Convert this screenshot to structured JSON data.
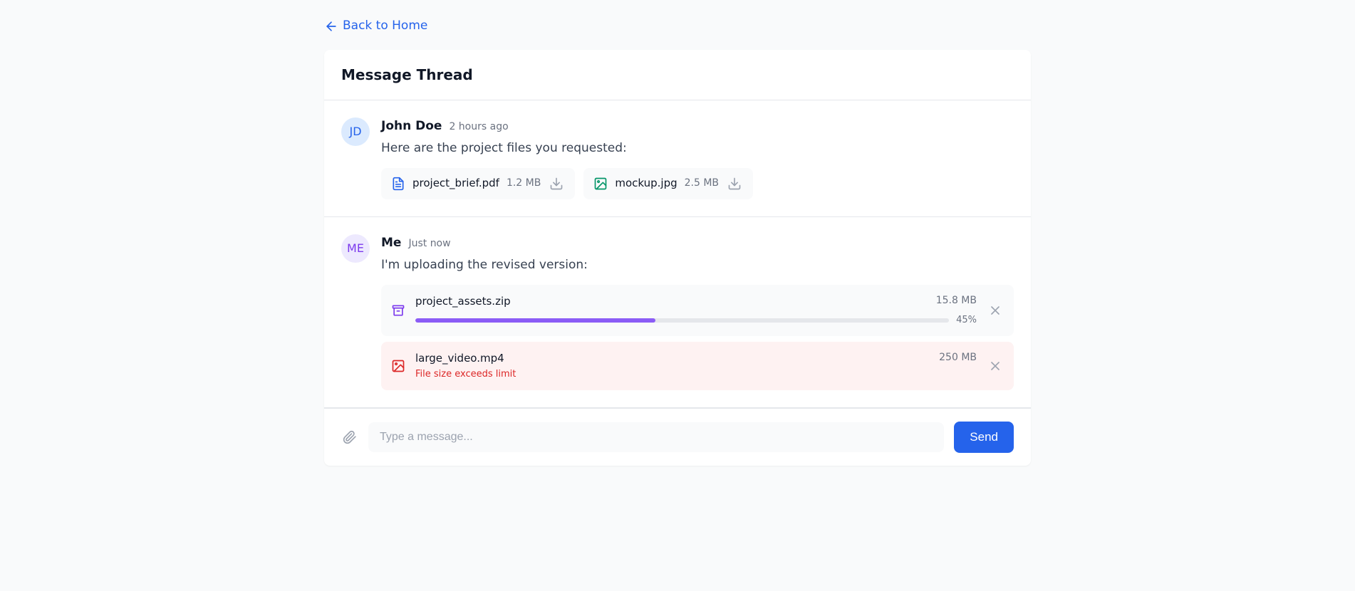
{
  "back_link": {
    "label": "Back to Home"
  },
  "thread": {
    "title": "Message Thread",
    "messages": [
      {
        "avatar_initials": "JD",
        "avatar_variant": "blue",
        "author": "John Doe",
        "time": "2 hours ago",
        "body": "Here are the project files you requested:",
        "attachments": [
          {
            "icon": "file-text-icon",
            "icon_color": "blue",
            "name": "project_brief.pdf",
            "size": "1.2 MB"
          },
          {
            "icon": "image-icon",
            "icon_color": "green",
            "name": "mockup.jpg",
            "size": "2.5 MB"
          }
        ]
      },
      {
        "avatar_initials": "ME",
        "avatar_variant": "purple",
        "author": "Me",
        "time": "Just now",
        "body": "I'm uploading the revised version:",
        "uploads": [
          {
            "icon": "archive-icon",
            "icon_color": "purple",
            "name": "project_assets.zip",
            "size": "15.8 MB",
            "progress": 45,
            "progress_label": "45%"
          },
          {
            "icon": "image-icon",
            "icon_color": "red",
            "name": "large_video.mp4",
            "size": "250 MB",
            "error": "File size exceeds limit"
          }
        ]
      }
    ]
  },
  "composer": {
    "placeholder": "Type a message...",
    "send_label": "Send"
  }
}
